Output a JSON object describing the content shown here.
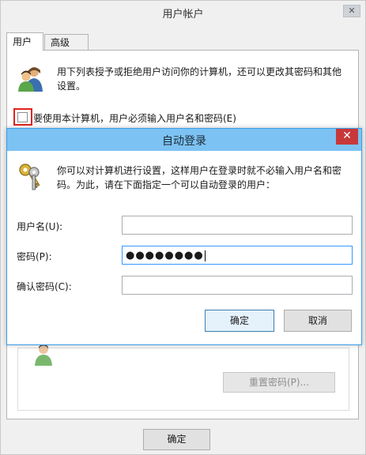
{
  "background_window": {
    "title": "用户帐户",
    "close_label": "✕",
    "tabs": [
      {
        "label": "用户",
        "active": true
      },
      {
        "label": "高级",
        "active": false
      }
    ],
    "intro_text": "用下列表授予或拒绝用户访问你的计算机，还可以更改其密码和其他设置。",
    "require_login_checkbox": {
      "label": "要使用本计算机，用户必须输入用户名和密码(E)",
      "checked": false
    },
    "reset_password_button": "重置密码(P)...",
    "ok_button": "确定",
    "icons": {
      "users": "users-icon",
      "user": "user-icon"
    }
  },
  "dialog": {
    "title": "自动登录",
    "close_label": "✕",
    "description": "你可以对计算机进行设置，这样用户在登录时就不必输入用户名和密码。为此，请在下面指定一个可以自动登录的用户：",
    "fields": {
      "username": {
        "label": "用户名(U):",
        "value": ""
      },
      "password": {
        "label": "密码(P):",
        "value": "●●●●●●●●"
      },
      "confirm_password": {
        "label": "确认密码(C):",
        "value": ""
      }
    },
    "ok_button": "确定",
    "cancel_button": "取消",
    "icons": {
      "keys": "keys-icon"
    }
  },
  "colors": {
    "dialog_titlebar": "#7cc2f2",
    "close_button": "#c7383a",
    "highlight_box": "#e0231b",
    "focus_border": "#3399ff"
  }
}
